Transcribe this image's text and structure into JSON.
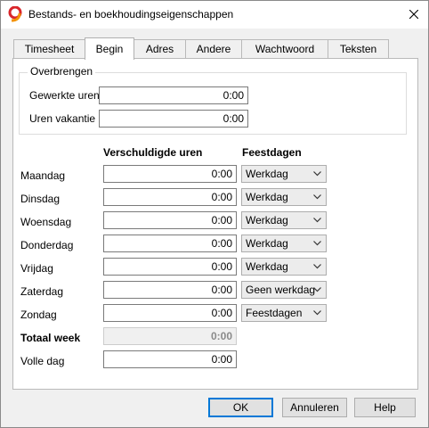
{
  "window": {
    "title": "Bestands- en boekhoudingseigenschappen",
    "icon": "app-logo-icon",
    "close": "close-icon"
  },
  "tabs": [
    {
      "label": "Timesheet",
      "active": false
    },
    {
      "label": "Begin",
      "active": true
    },
    {
      "label": "Adres",
      "active": false
    },
    {
      "label": "Andere",
      "active": false
    },
    {
      "label": "Wachtwoord",
      "active": false
    },
    {
      "label": "Teksten",
      "active": false
    }
  ],
  "transfer": {
    "legend": "Overbrengen",
    "worked_hours": {
      "label": "Gewerkte uren",
      "value": "0:00"
    },
    "vacation_hours": {
      "label": "Uren vakantie",
      "value": "0:00"
    }
  },
  "schedule": {
    "hours_header": "Verschuldigde uren",
    "holidays_header": "Feestdagen",
    "days": [
      {
        "label": "Maandag",
        "hours": "0:00",
        "type": "Werkdag"
      },
      {
        "label": "Dinsdag",
        "hours": "0:00",
        "type": "Werkdag"
      },
      {
        "label": "Woensdag",
        "hours": "0:00",
        "type": "Werkdag"
      },
      {
        "label": "Donderdag",
        "hours": "0:00",
        "type": "Werkdag"
      },
      {
        "label": "Vrijdag",
        "hours": "0:00",
        "type": "Werkdag"
      },
      {
        "label": "Zaterdag",
        "hours": "0:00",
        "type": "Geen werkdag"
      },
      {
        "label": "Zondag",
        "hours": "0:00",
        "type": "Feestdagen"
      }
    ],
    "total_week": {
      "label": "Totaal week",
      "value": "0:00"
    },
    "full_day": {
      "label": "Volle dag",
      "value": "0:00"
    }
  },
  "buttons": {
    "ok": "OK",
    "cancel": "Annuleren",
    "help": "Help"
  },
  "colors": {
    "accent": "#0078d7",
    "logo_red": "#d9262b",
    "logo_orange": "#f39200"
  }
}
